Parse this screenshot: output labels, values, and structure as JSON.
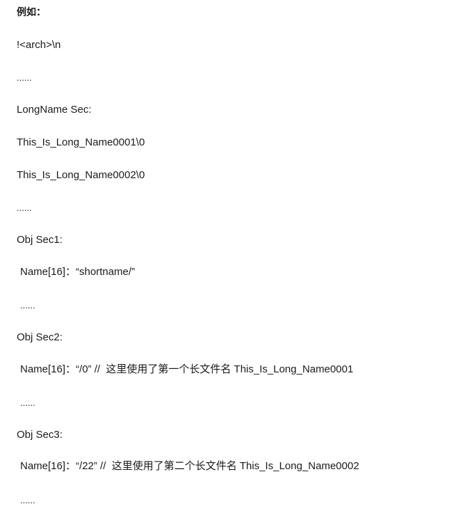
{
  "document": {
    "lines": [
      {
        "text": "例如："
      },
      {
        "text": "!<arch>\\n"
      },
      {
        "text": "......"
      },
      {
        "text": "LongName Sec:"
      },
      {
        "text": "This_Is_Long_Name0001\\0"
      },
      {
        "text": "This_Is_Long_Name0002\\0"
      },
      {
        "text": "......"
      },
      {
        "text": "Obj Sec1:"
      },
      {
        "text": "Name[16]：“shortname/”"
      },
      {
        "text": "......"
      },
      {
        "text": "Obj Sec2:"
      },
      {
        "text": "Name[16]：“/0” //  这里使用了第一个长文件名 This_Is_Long_Name0001"
      },
      {
        "text": "......"
      },
      {
        "text": "Obj Sec3:"
      },
      {
        "text": "Name[16]：“/22” //  这里使用了第二个长文件名 This_Is_Long_Name0002"
      },
      {
        "text": "......"
      }
    ]
  }
}
